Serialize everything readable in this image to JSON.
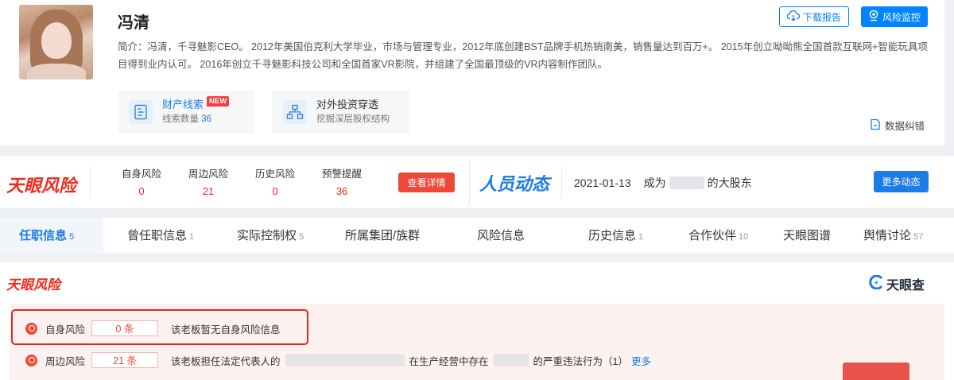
{
  "profile": {
    "name": "冯清",
    "intro": "简介：冯清，千寻魅影CEO。 2012年美国伯克利大学毕业，市场与管理专业，2012年底创建BST品牌手机热销南美，销售量达到百万+。 2015年创立呦呦熊全国首款互联网+智能玩具项目得到业内认可。 2016年创立千寻魅影科技公司和全国首家VR影院，并组建了全国最顶级的VR内容制作团队。",
    "download_label": "下载报告",
    "monitor_label": "风险监控",
    "feature_assets": {
      "title": "财产线索",
      "badge": "NEW",
      "sub_label": "线索数量",
      "count": "36"
    },
    "feature_invest": {
      "title": "对外投资穿透",
      "sub": "挖掘深层股权结构"
    },
    "correction_label": "数据纠错"
  },
  "risk_strip": {
    "logo": "天眼风险",
    "items": [
      {
        "label": "自身风险",
        "value": "0"
      },
      {
        "label": "周边风险",
        "value": "21"
      },
      {
        "label": "历史风险",
        "value": "0"
      },
      {
        "label": "预警提醒",
        "value": "36"
      }
    ],
    "detail_button": "查看详情",
    "people_logo": "人员动态",
    "people_date": "2021-01-13",
    "people_prefix": "成为",
    "people_suffix": "的大股东",
    "more_button": "更多动态"
  },
  "tabs": [
    {
      "label": "任职信息",
      "count": "5"
    },
    {
      "label": "曾任职信息",
      "count": "1"
    },
    {
      "label": "实际控制权",
      "count": "5"
    },
    {
      "label": "所属集团/族群",
      "count": ""
    },
    {
      "label": "风险信息",
      "count": ""
    },
    {
      "label": "历史信息",
      "count": "1"
    },
    {
      "label": "合作伙伴",
      "count": "10"
    },
    {
      "label": "天眼图谱",
      "count": ""
    },
    {
      "label": "舆情讨论",
      "count": "57"
    }
  ],
  "risk_section": {
    "logo": "天眼风险",
    "brand": "天眼查",
    "rows": [
      {
        "label": "自身风险",
        "pill": "0 条",
        "text": "该老板暂无自身风险信息"
      },
      {
        "label": "周边风险",
        "pill": "21 条",
        "text_prefix": "该老板担任法定代表人的",
        "text_mid": "在生产经营中存在",
        "text_suffix": "的严重违法行为（1）",
        "more": "更多"
      }
    ]
  },
  "colors": {
    "accent_blue": "#1d7be6",
    "risk_red": "#f0291c",
    "button_blue": "#0084ff"
  }
}
